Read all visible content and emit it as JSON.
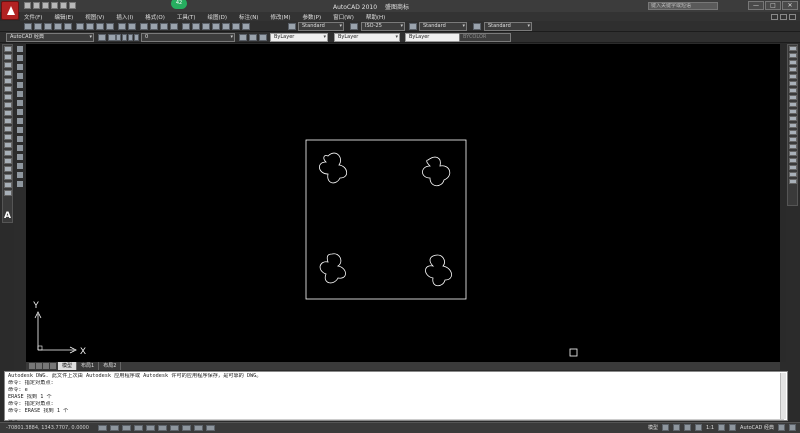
{
  "window": {
    "app_name": "AutoCAD 2010",
    "doc_name": "盛图商标",
    "search_placeholder": "键入关键字或短语",
    "badge": "42",
    "controls": [
      "—",
      "□",
      "✕"
    ]
  },
  "menu": [
    "文件(F)",
    "编辑(E)",
    "视图(V)",
    "插入(I)",
    "格式(O)",
    "工具(T)",
    "绘图(D)",
    "标注(N)",
    "修改(M)",
    "参数(P)",
    "窗口(W)",
    "帮助(H)"
  ],
  "toolbar1": {
    "text_style": "Standard",
    "dim_style": "ISO-25",
    "table_style": "Standard",
    "multileader_style": "Standard"
  },
  "toolbar2": {
    "workspace": "AutoCAD 经典",
    "layer": "0",
    "color": "ByLayer",
    "linetype": "ByLayer",
    "lineweight": "ByLayer",
    "plotstyle": "BYCOLOR"
  },
  "canvas": {
    "ucs_y_label": "Y",
    "ucs_x_label": "X"
  },
  "layout_tabs": [
    "模型",
    "布局1",
    "布局2"
  ],
  "command_history": [
    "Autodesk DWG.  此文件上次由 Autodesk 应用程序或 Autodesk 许可的应用程序保存，是可靠的 DWG。",
    "命令:  指定对角点:",
    "命令: e",
    "ERASE 找到 1 个",
    "命令:  指定对角点:",
    "命令:  ERASE 找到 1 个"
  ],
  "command_prompt": "命令:",
  "status": {
    "coords": "-70801.3884, 1343.7707, 0.0000",
    "model_label": "模型",
    "scale_label": "1:1",
    "workspace_label": "AutoCAD 经典"
  },
  "colors": {
    "canvas_bg": "#000000",
    "geometry_stroke": "#ffffff",
    "app_button": "#b22222",
    "badge": "#27ae60"
  }
}
